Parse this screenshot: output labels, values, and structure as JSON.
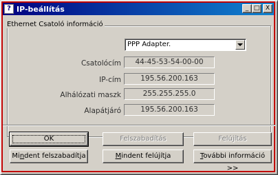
{
  "window": {
    "title": "IP-beállítás",
    "title_icon": "question-network-icon",
    "buttons": {
      "minimize": "_",
      "maximize": "□",
      "close": "X"
    }
  },
  "group": {
    "legend": "Ethernet  Csatoló információ",
    "adapter_select": {
      "value": "PPP Adapter."
    }
  },
  "fields": [
    {
      "label": "Csatolócím",
      "value": "44-45-53-54-00-00"
    },
    {
      "label": "IP-cím",
      "value": "195.56.200.163"
    },
    {
      "label": "Alhálózati maszk",
      "value": "255.255.255.0"
    },
    {
      "label": "Alapátjáró",
      "value": "195.56.200.163"
    }
  ],
  "buttons_row1": {
    "ok": "OK",
    "release": "Felszabadítás",
    "renew": "Felújítás"
  },
  "buttons_row2": {
    "release_all_pre": "Mi",
    "release_all_u": "n",
    "release_all_post": "dent felszabadítja",
    "renew_all_u": "M",
    "renew_all_post": "indent felújítja",
    "more_info_u": "T",
    "more_info_post": "ovábbi információ >>"
  }
}
